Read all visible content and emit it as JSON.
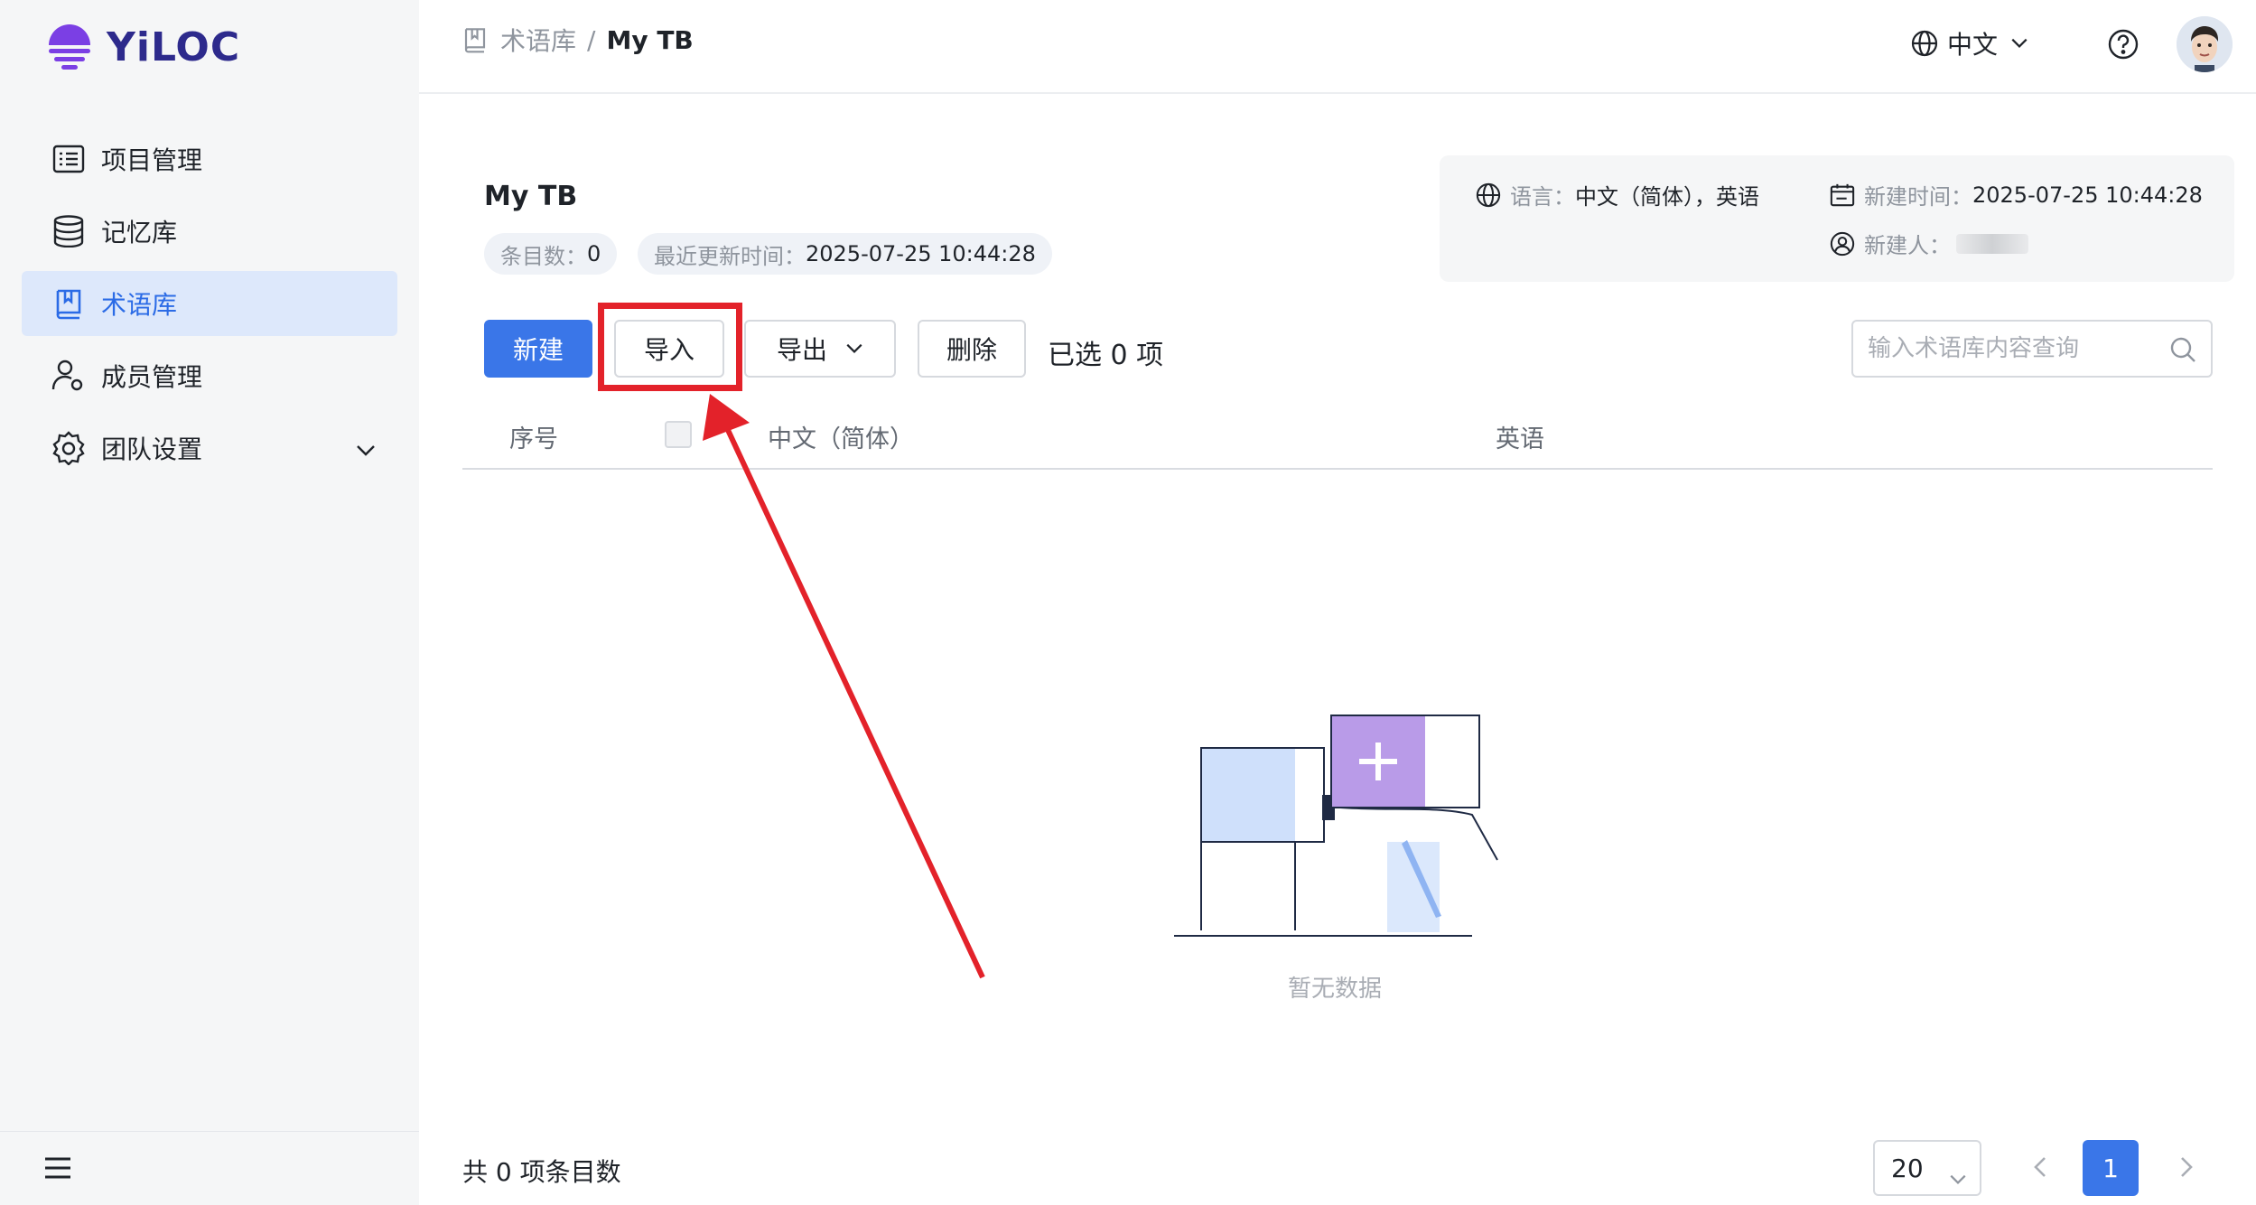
{
  "app": {
    "logo_text": "YiLOC"
  },
  "sidebar": {
    "items": [
      {
        "label": "项目管理",
        "icon": "list-icon"
      },
      {
        "label": "记忆库",
        "icon": "database-icon"
      },
      {
        "label": "术语库",
        "icon": "book-icon",
        "active": true
      },
      {
        "label": "成员管理",
        "icon": "user-gear-icon"
      },
      {
        "label": "团队设置",
        "icon": "gear-icon",
        "expandable": true
      }
    ]
  },
  "header": {
    "breadcrumb": {
      "parent": "术语库",
      "separator": "/",
      "current": "My TB"
    },
    "language": "中文"
  },
  "termbase": {
    "title": "My TB",
    "entry_count_label": "条目数：",
    "entry_count": "0",
    "updated_label": "最近更新时间：",
    "updated_value": "2025-07-25 10:44:28",
    "info": {
      "language_label": "语言：",
      "language_value": "中文（简体），英语",
      "created_label": "新建时间：",
      "created_value": "2025-07-25 10:44:28",
      "creator_label": "新建人："
    }
  },
  "toolbar": {
    "new_label": "新建",
    "import_label": "导入",
    "export_label": "导出",
    "delete_label": "删除",
    "selected_text": "已选 0 项",
    "search_placeholder": "输入术语库内容查询"
  },
  "table": {
    "columns": [
      "序号",
      "中文（简体）",
      "英语"
    ],
    "rows": []
  },
  "empty_state": {
    "text": "暂无数据"
  },
  "footer": {
    "total_text": "共 0 项条目数",
    "page_size": "20",
    "current_page": "1"
  },
  "colors": {
    "primary": "#3a76e8",
    "highlight": "#e3222a",
    "logo": "#2d2a8c",
    "active_bg": "#dde8fb"
  }
}
